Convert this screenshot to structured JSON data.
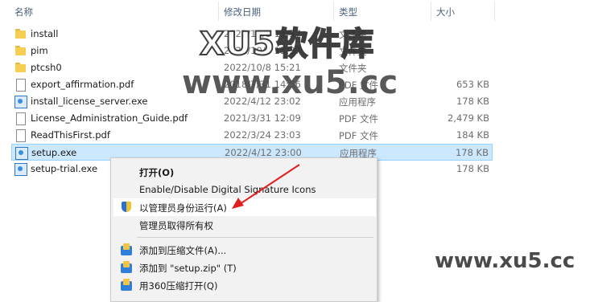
{
  "columns": {
    "name": "名称",
    "date": "修改日期",
    "type": "类型",
    "size": "大小"
  },
  "files": [
    {
      "name": "install",
      "date": "2022/10/8 15:37",
      "type": "文件夹",
      "size": "",
      "icon": "folder-icon"
    },
    {
      "name": "pim",
      "date": "2022/10/8 15:37",
      "type": "文件夹",
      "size": "",
      "icon": "folder-icon"
    },
    {
      "name": "ptcsh0",
      "date": "2022/10/8 15:21",
      "type": "文件夹",
      "size": "",
      "icon": "folder-icon"
    },
    {
      "name": "export_affirmation.pdf",
      "date": "2018/7/31 14:56",
      "type": "PDF 文件",
      "size": "653 KB",
      "icon": "pdf-file-icon"
    },
    {
      "name": "install_license_server.exe",
      "date": "2022/4/12 23:02",
      "type": "应用程序",
      "size": "178 KB",
      "icon": "application-icon"
    },
    {
      "name": "License_Administration_Guide.pdf",
      "date": "2021/3/31 12:09",
      "type": "PDF 文件",
      "size": "2,479 KB",
      "icon": "pdf-file-icon"
    },
    {
      "name": "ReadThisFirst.pdf",
      "date": "2022/3/24 23:03",
      "type": "PDF 文件",
      "size": "184 KB",
      "icon": "pdf-file-icon"
    },
    {
      "name": "setup.exe",
      "date": "2022/4/12 23:00",
      "type": "应用程序",
      "size": "178 KB",
      "icon": "application-icon",
      "selected": true
    },
    {
      "name": "setup-trial.exe",
      "date": "",
      "type": "",
      "size": "178 KB",
      "icon": "application-icon"
    }
  ],
  "context_menu": {
    "items": [
      {
        "label": "打开(O)",
        "bold": true
      },
      {
        "label": "Enable/Disable Digital Signature Icons"
      },
      {
        "label": "以管理员身份运行(A)",
        "icon": "uac-shield-icon",
        "highlighted": true
      },
      {
        "label": "管理员取得所有权"
      },
      {
        "label": "添加到压缩文件(A)...",
        "icon": "archive-icon"
      },
      {
        "label": "添加到 \"setup.zip\" (T)",
        "icon": "archive-icon"
      },
      {
        "label": "用360压缩打开(Q)",
        "icon": "archive-icon"
      }
    ]
  },
  "watermark": {
    "line1": "XU5软件库",
    "line2": "www.xu5.cc",
    "corner": "www.xu5.cc"
  },
  "colors": {
    "selection_bg": "#cce8ff",
    "selection_border": "#99d1ff",
    "menu_bg": "#f2f2f2",
    "arrow": "#e02020"
  }
}
